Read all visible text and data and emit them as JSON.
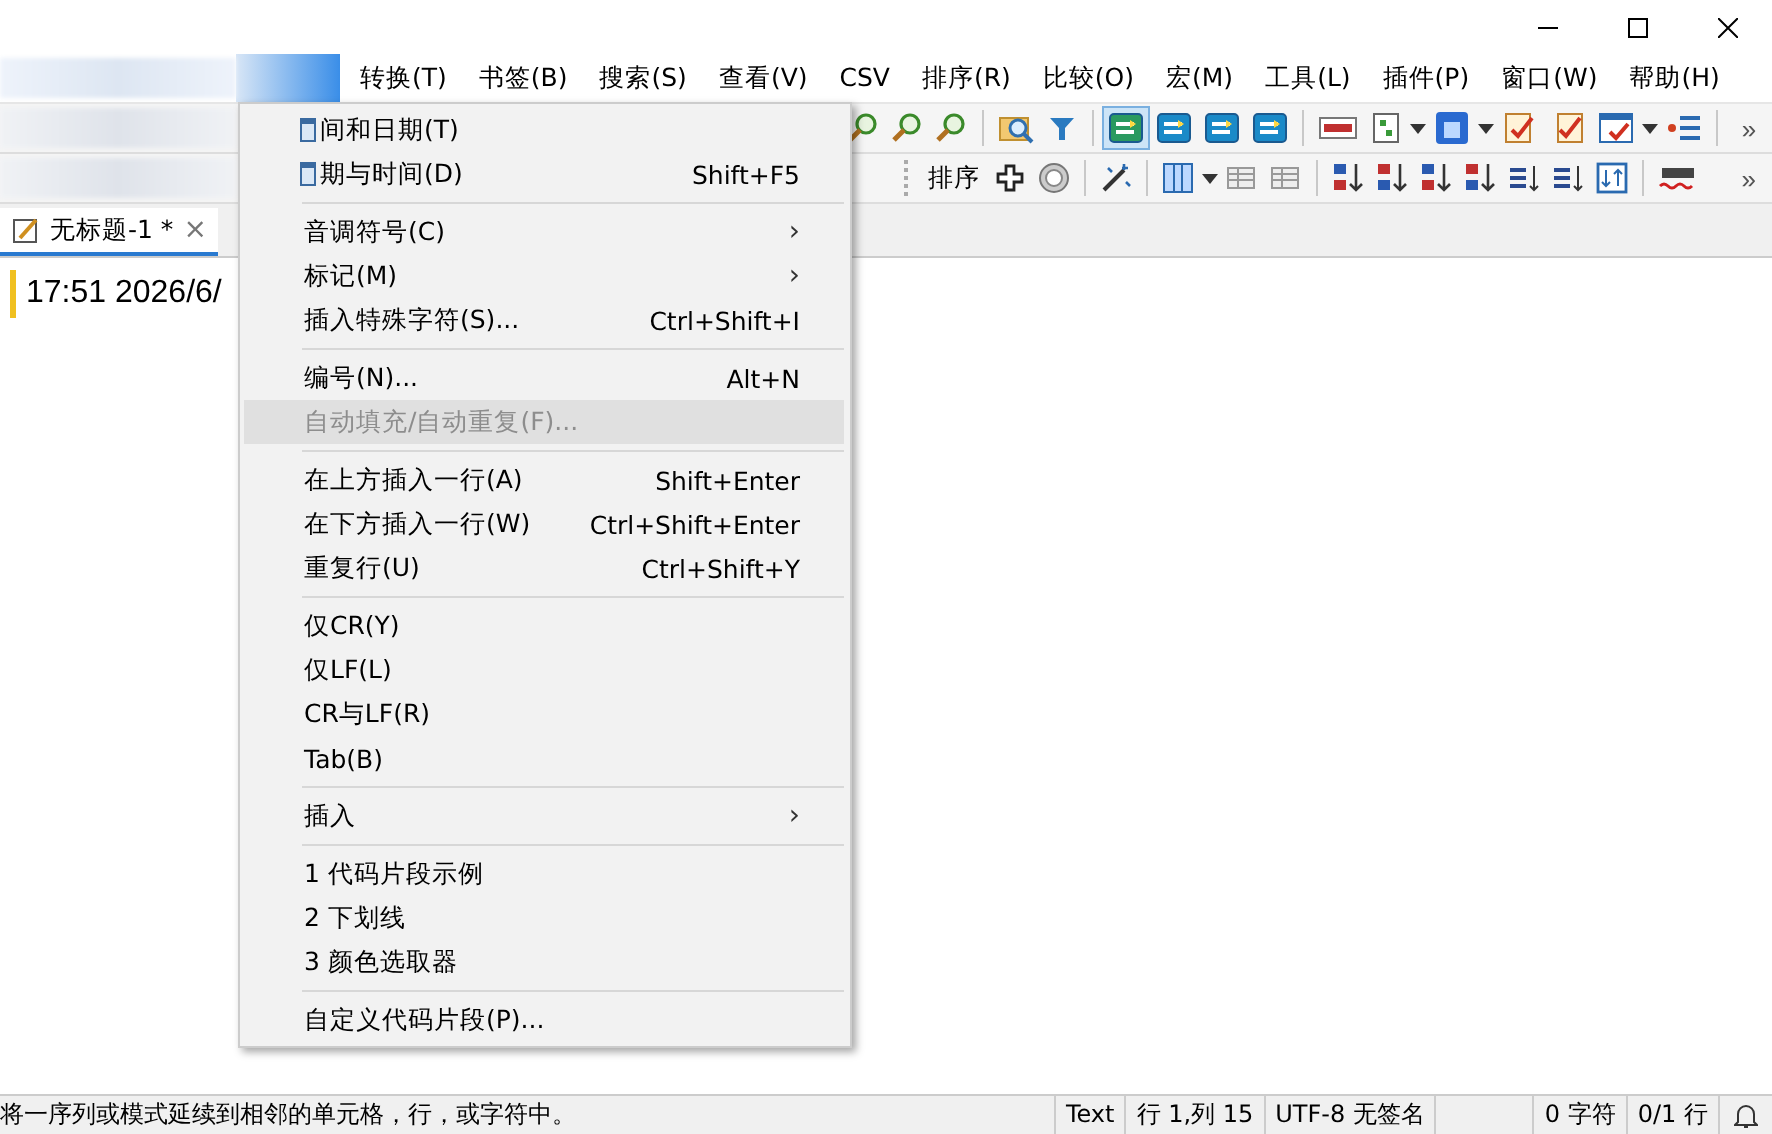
{
  "menubar": [
    {
      "label": "转换(T)"
    },
    {
      "label": "书签(B)"
    },
    {
      "label": "搜索(S)"
    },
    {
      "label": "查看(V)"
    },
    {
      "label": "CSV"
    },
    {
      "label": "排序(R)"
    },
    {
      "label": "比较(O)"
    },
    {
      "label": "宏(M)"
    },
    {
      "label": "工具(L)"
    },
    {
      "label": "插件(P)"
    },
    {
      "label": "窗口(W)"
    },
    {
      "label": "帮助(H)"
    }
  ],
  "toolbar_1": [
    {
      "kind": "zoom-in",
      "pressed": false
    },
    {
      "kind": "zoom-out",
      "pressed": false
    },
    {
      "kind": "find-files",
      "pressed": false
    },
    {
      "kind": "sep"
    },
    {
      "kind": "folder-search",
      "pressed": false
    },
    {
      "kind": "filter",
      "pressed": false
    },
    {
      "kind": "sep"
    },
    {
      "kind": "wrap",
      "pressed": true
    },
    {
      "kind": "swap",
      "pressed": false
    },
    {
      "kind": "return",
      "pressed": false
    },
    {
      "kind": "export",
      "pressed": false
    },
    {
      "kind": "sep"
    },
    {
      "kind": "abc",
      "pressed": false
    },
    {
      "kind": "tree",
      "pressed": false
    },
    {
      "kind": "caret"
    },
    {
      "kind": "blue-doc",
      "pressed": false
    },
    {
      "kind": "caret"
    },
    {
      "kind": "check-doc",
      "pressed": false
    },
    {
      "kind": "check-docs",
      "pressed": false
    },
    {
      "kind": "window",
      "pressed": false
    },
    {
      "kind": "caret"
    },
    {
      "kind": "list",
      "pressed": false
    },
    {
      "kind": "sep"
    }
  ],
  "toolbar_1_more": "»",
  "toolbar_2_label": "排序",
  "toolbar_2": [
    {
      "kind": "plus",
      "pressed": false
    },
    {
      "kind": "circle",
      "pressed": false
    },
    {
      "kind": "sep"
    },
    {
      "kind": "wand",
      "pressed": false
    },
    {
      "kind": "sep"
    },
    {
      "kind": "columns",
      "pressed": false
    },
    {
      "kind": "caret"
    },
    {
      "kind": "grid-grey",
      "pressed": false
    },
    {
      "kind": "grid-grey",
      "pressed": false
    },
    {
      "kind": "sep"
    },
    {
      "kind": "sort-az",
      "pressed": false
    },
    {
      "kind": "sort-za",
      "pressed": false
    },
    {
      "kind": "sort-09",
      "pressed": false
    },
    {
      "kind": "sort-90",
      "pressed": false
    },
    {
      "kind": "sort-lines",
      "pressed": false
    },
    {
      "kind": "sort-lines",
      "pressed": false
    },
    {
      "kind": "sort-box",
      "pressed": false
    },
    {
      "kind": "sep"
    },
    {
      "kind": "spell",
      "pressed": false
    }
  ],
  "toolbar_2_more": "»",
  "tab": {
    "label": "无标题-1 *",
    "close": "×",
    "selected": true
  },
  "editor": {
    "text": "17:51 2026/6/"
  },
  "menu": [
    {
      "kind": "item",
      "icon": true,
      "label": "间和日期(T)",
      "highlighted": false,
      "disabled": false
    },
    {
      "kind": "item",
      "icon": true,
      "label": "期与时间(D)",
      "shortcut": "Shift+F5",
      "highlighted": false,
      "disabled": false
    },
    {
      "kind": "separator"
    },
    {
      "kind": "item",
      "label": "音调符号(C)",
      "submenu": "›",
      "highlighted": false,
      "disabled": false
    },
    {
      "kind": "item",
      "label": "标记(M)",
      "submenu": "›",
      "highlighted": false,
      "disabled": false
    },
    {
      "kind": "item",
      "label": "插入特殊字符(S)...",
      "shortcut": "Ctrl+Shift+I",
      "highlighted": false,
      "disabled": false
    },
    {
      "kind": "separator"
    },
    {
      "kind": "item",
      "label": "编号(N)...",
      "shortcut": "Alt+N",
      "highlighted": false,
      "disabled": false
    },
    {
      "kind": "item",
      "label": "自动填充/自动重复(F)...",
      "highlighted": true,
      "disabled": true
    },
    {
      "kind": "separator"
    },
    {
      "kind": "item",
      "label": "在上方插入一行(A)",
      "shortcut": "Shift+Enter",
      "highlighted": false,
      "disabled": false
    },
    {
      "kind": "item",
      "label": "在下方插入一行(W)",
      "shortcut": "Ctrl+Shift+Enter",
      "highlighted": false,
      "disabled": false
    },
    {
      "kind": "item",
      "label": "重复行(U)",
      "shortcut": "Ctrl+Shift+Y",
      "highlighted": false,
      "disabled": false
    },
    {
      "kind": "separator"
    },
    {
      "kind": "item",
      "label": "仅CR(Y)",
      "highlighted": false,
      "disabled": false
    },
    {
      "kind": "item",
      "label": "仅LF(L)",
      "highlighted": false,
      "disabled": false
    },
    {
      "kind": "item",
      "label": "CR与LF(R)",
      "highlighted": false,
      "disabled": false
    },
    {
      "kind": "item",
      "label": "Tab(B)",
      "highlighted": false,
      "disabled": false
    },
    {
      "kind": "separator"
    },
    {
      "kind": "item",
      "label": "插入",
      "submenu": "›",
      "highlighted": false,
      "disabled": false
    },
    {
      "kind": "separator"
    },
    {
      "kind": "item",
      "label": "1 代码片段示例",
      "highlighted": false,
      "disabled": false
    },
    {
      "kind": "item",
      "label": "2 下划线",
      "highlighted": false,
      "disabled": false
    },
    {
      "kind": "item",
      "label": "3 颜色选取器",
      "highlighted": false,
      "disabled": false
    },
    {
      "kind": "separator"
    },
    {
      "kind": "item",
      "label": "自定义代码片段(P)...",
      "highlighted": false,
      "disabled": false
    }
  ],
  "status_bar": {
    "message": "将一序列或模式延续到相邻的单元格，行，或字符中。",
    "mode": "Text",
    "position": "行 1,列 15",
    "encoding": "UTF-8 无签名",
    "chars": "0 字符",
    "lines": "0/1 行"
  }
}
